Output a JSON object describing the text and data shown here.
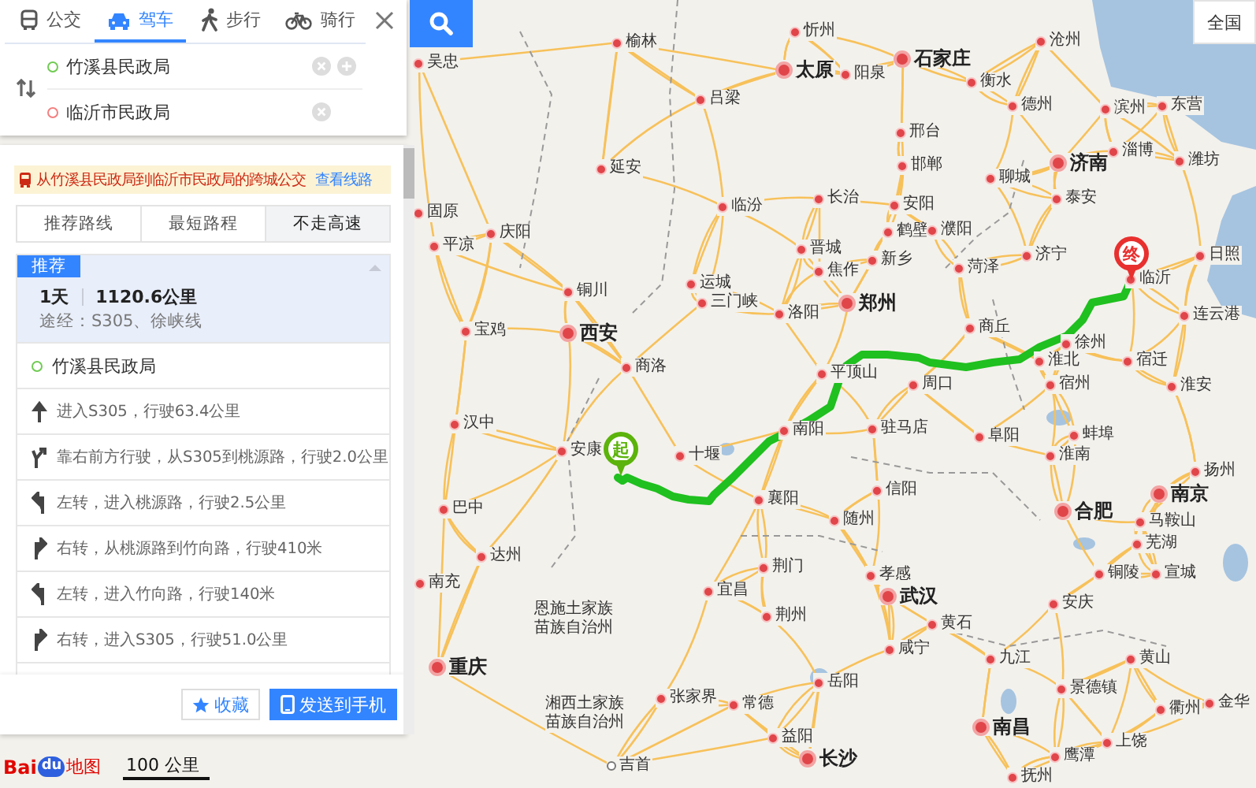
{
  "search": {
    "modes": [
      {
        "kind": "bus",
        "label": "公交",
        "selected": false
      },
      {
        "kind": "car",
        "label": "驾车",
        "selected": true
      },
      {
        "kind": "walk",
        "label": "步行",
        "selected": false
      },
      {
        "kind": "bike",
        "label": "骑行",
        "selected": false
      }
    ],
    "waypoints": [
      {
        "kind": "start",
        "value": "竹溪县民政局",
        "can_add": true
      },
      {
        "kind": "end",
        "value": "临沂市民政局",
        "can_add": false
      }
    ]
  },
  "notice": {
    "text": "从竹溪县民政局到临沂市民政局的跨城公交",
    "link": "查看线路"
  },
  "strategies": [
    {
      "label": "推荐路线",
      "selected": false
    },
    {
      "label": "最短路程",
      "selected": false
    },
    {
      "label": "不走高速",
      "selected": true
    }
  ],
  "route": {
    "badge": "推荐",
    "duration": "1天",
    "distance": "1120.6公里",
    "via": "途经：S305、徐峡线",
    "expanded": true
  },
  "steps": [
    {
      "kind": "start",
      "text": "竹溪县民政局"
    },
    {
      "kind": "straight",
      "text": "进入S305，行驶63.4公里"
    },
    {
      "kind": "fork-right",
      "text": "靠右前方行驶，从S305到桃源路，行驶2.0公里"
    },
    {
      "kind": "left",
      "text": "左转，进入桃源路，行驶2.5公里"
    },
    {
      "kind": "right",
      "text": "右转，从桃源路到竹向路，行驶410米"
    },
    {
      "kind": "left",
      "text": "左转，进入竹向路，行驶140米"
    },
    {
      "kind": "right",
      "text": "右转，进入S305，行驶51.0公里"
    }
  ],
  "actions": [
    {
      "kind": "favorite",
      "label": "收藏"
    },
    {
      "kind": "send",
      "label": "发送到手机"
    }
  ],
  "map": {
    "scope_button": "全国",
    "start_marker": "起",
    "end_marker": "终",
    "scale": "100 公里",
    "cities": [
      {
        "name": "忻州",
        "kind": "city"
      },
      {
        "name": "榆林",
        "kind": "city"
      },
      {
        "name": "石家庄",
        "kind": "capital"
      },
      {
        "name": "太原",
        "kind": "capital"
      },
      {
        "name": "阳泉",
        "kind": "city"
      },
      {
        "name": "沧州",
        "kind": "city"
      },
      {
        "name": "衡水",
        "kind": "city"
      },
      {
        "name": "吕梁",
        "kind": "city"
      },
      {
        "name": "德州",
        "kind": "city"
      },
      {
        "name": "滨州",
        "kind": "city"
      },
      {
        "name": "东营",
        "kind": "city"
      },
      {
        "name": "邢台",
        "kind": "city"
      },
      {
        "name": "延安",
        "kind": "city"
      },
      {
        "name": "邯郸",
        "kind": "city"
      },
      {
        "name": "济南",
        "kind": "capital"
      },
      {
        "name": "淄博",
        "kind": "city"
      },
      {
        "name": "潍坊",
        "kind": "city"
      },
      {
        "name": "聊城",
        "kind": "city"
      },
      {
        "name": "临汾",
        "kind": "city"
      },
      {
        "name": "长治",
        "kind": "city"
      },
      {
        "name": "安阳",
        "kind": "city"
      },
      {
        "name": "泰安",
        "kind": "city"
      },
      {
        "name": "庆阳",
        "kind": "city"
      },
      {
        "name": "平凉",
        "kind": "city"
      },
      {
        "name": "鹤壁",
        "kind": "city"
      },
      {
        "name": "濮阳",
        "kind": "city"
      },
      {
        "name": "晋城",
        "kind": "city"
      },
      {
        "name": "济宁",
        "kind": "city"
      },
      {
        "name": "日照",
        "kind": "city"
      },
      {
        "name": "临沂",
        "kind": "city"
      },
      {
        "name": "焦作",
        "kind": "city"
      },
      {
        "name": "新乡",
        "kind": "city"
      },
      {
        "name": "菏泽",
        "kind": "city"
      },
      {
        "name": "运城",
        "kind": "city"
      },
      {
        "name": "铜川",
        "kind": "city"
      },
      {
        "name": "三门峡",
        "kind": "city"
      },
      {
        "name": "洛阳",
        "kind": "city"
      },
      {
        "name": "郑州",
        "kind": "capital"
      },
      {
        "name": "宝鸡",
        "kind": "city"
      },
      {
        "name": "西安",
        "kind": "capital"
      },
      {
        "name": "商丘",
        "kind": "city"
      },
      {
        "name": "徐州",
        "kind": "city"
      },
      {
        "name": "连云港",
        "kind": "city"
      },
      {
        "name": "淮北",
        "kind": "city"
      },
      {
        "name": "宿迁",
        "kind": "city"
      },
      {
        "name": "商洛",
        "kind": "city"
      },
      {
        "name": "平顶山",
        "kind": "city"
      },
      {
        "name": "周口",
        "kind": "city"
      },
      {
        "name": "宿州",
        "kind": "city"
      },
      {
        "name": "淮安",
        "kind": "city"
      },
      {
        "name": "汉中",
        "kind": "city"
      },
      {
        "name": "安康",
        "kind": "city"
      },
      {
        "name": "十堰",
        "kind": "city"
      },
      {
        "name": "南阳",
        "kind": "city"
      },
      {
        "name": "驻马店",
        "kind": "city"
      },
      {
        "name": "阜阳",
        "kind": "city"
      },
      {
        "name": "蚌埠",
        "kind": "city"
      },
      {
        "name": "淮南",
        "kind": "city"
      },
      {
        "name": "扬州",
        "kind": "city"
      },
      {
        "name": "巴中",
        "kind": "city"
      },
      {
        "name": "襄阳",
        "kind": "city"
      },
      {
        "name": "信阳",
        "kind": "city"
      },
      {
        "name": "合肥",
        "kind": "capital"
      },
      {
        "name": "南京",
        "kind": "capital"
      },
      {
        "name": "随州",
        "kind": "city"
      },
      {
        "name": "马鞍山",
        "kind": "city"
      },
      {
        "name": "芜湖",
        "kind": "city"
      },
      {
        "name": "达州",
        "kind": "city"
      },
      {
        "name": "荆门",
        "kind": "city"
      },
      {
        "name": "孝感",
        "kind": "city"
      },
      {
        "name": "铜陵",
        "kind": "city"
      },
      {
        "name": "宣城",
        "kind": "city"
      },
      {
        "name": "宜昌",
        "kind": "city"
      },
      {
        "name": "武汉",
        "kind": "capital"
      },
      {
        "name": "安庆",
        "kind": "city"
      },
      {
        "name": "荆州",
        "kind": "city"
      },
      {
        "name": "黄石",
        "kind": "city"
      },
      {
        "name": "咸宁",
        "kind": "city"
      },
      {
        "name": "九江",
        "kind": "city"
      },
      {
        "name": "黄山",
        "kind": "city"
      },
      {
        "name": "重庆",
        "kind": "capital"
      },
      {
        "name": "岳阳",
        "kind": "city"
      },
      {
        "name": "景德镇",
        "kind": "city"
      },
      {
        "name": "张家界",
        "kind": "city"
      },
      {
        "name": "常德",
        "kind": "city"
      },
      {
        "name": "衢州",
        "kind": "city"
      },
      {
        "name": "金华",
        "kind": "city"
      },
      {
        "name": "南昌",
        "kind": "capital"
      },
      {
        "name": "益阳",
        "kind": "city"
      },
      {
        "name": "上饶",
        "kind": "city"
      },
      {
        "name": "鹰潭",
        "kind": "city"
      },
      {
        "name": "吉首",
        "kind": "town"
      },
      {
        "name": "长沙",
        "kind": "capital"
      },
      {
        "name": "抚州",
        "kind": "city"
      },
      {
        "name": "吴忠",
        "kind": "city"
      },
      {
        "name": "固原",
        "kind": "city"
      },
      {
        "name": "南充",
        "kind": "city"
      },
      {
        "name": "恩施土家族苗族自治州",
        "kind": "region"
      },
      {
        "name": "湘西土家族苗族自治州",
        "kind": "region"
      }
    ]
  },
  "logo": {
    "left": "Bai",
    "paw": "du",
    "right": "地图"
  }
}
